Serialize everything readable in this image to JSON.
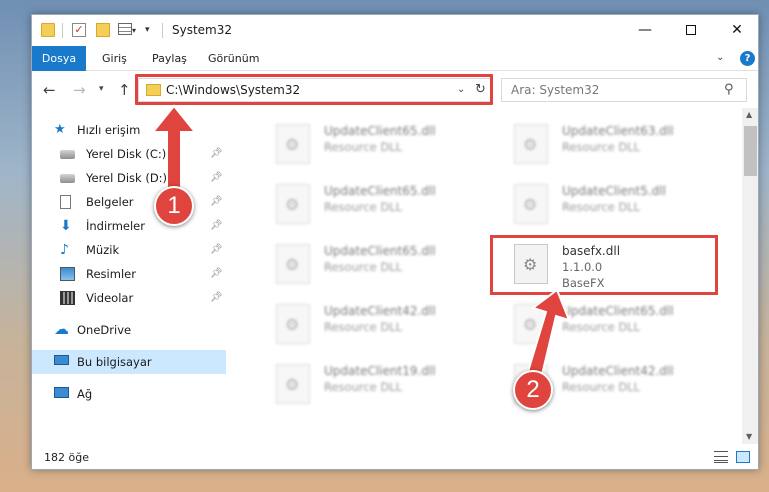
{
  "window": {
    "title": "System32",
    "controls": {
      "minimize": "—",
      "close": "✕"
    }
  },
  "ribbon": {
    "tabs": [
      "Dosya",
      "Giriş",
      "Paylaş",
      "Görünüm"
    ],
    "help": "?"
  },
  "address": {
    "path": "C:\\Windows\\System32",
    "search_placeholder": "Ara: System32"
  },
  "sidebar": {
    "items": [
      {
        "label": "Hızlı erişim",
        "icon": "star-icon"
      },
      {
        "label": "Yerel Disk (C:)",
        "icon": "disk-icon"
      },
      {
        "label": "Yerel Disk (D:)",
        "icon": "disk-icon"
      },
      {
        "label": "Belgeler",
        "icon": "documents-icon"
      },
      {
        "label": "İndirmeler",
        "icon": "downloads-icon"
      },
      {
        "label": "Müzik",
        "icon": "music-icon"
      },
      {
        "label": "Resimler",
        "icon": "pictures-icon"
      },
      {
        "label": "Videolar",
        "icon": "videos-icon"
      },
      {
        "label": "OneDrive",
        "icon": "onedrive-icon"
      },
      {
        "label": "Bu bilgisayar",
        "icon": "this-pc-icon",
        "selected": true
      },
      {
        "label": "Ağ",
        "icon": "network-icon"
      }
    ]
  },
  "files": [
    {
      "name": "UpdateClient65.dll",
      "desc": "Resource DLL"
    },
    {
      "name": "UpdateClient63.dll",
      "desc": "Resource DLL"
    },
    {
      "name": "UpdateClient65.dll",
      "desc": "Resource DLL"
    },
    {
      "name": "UpdateClient5.dll",
      "desc": "Resource DLL"
    },
    {
      "name": "UpdateClient65.dll",
      "desc": "Resource DLL"
    },
    {
      "name": "basefx.dll",
      "version": "1.1.0.0",
      "desc": "BaseFX",
      "highlighted": true
    },
    {
      "name": "UpdateClient42.dll",
      "desc": "Resource DLL"
    },
    {
      "name": "UpdateClient65.dll",
      "desc": "Resource DLL"
    },
    {
      "name": "UpdateClient19.dll",
      "desc": "Resource DLL"
    },
    {
      "name": "UpdateClient42.dll",
      "desc": "Resource DLL"
    }
  ],
  "status": {
    "count": "182 öğe"
  },
  "callouts": {
    "step1": "1",
    "step2": "2",
    "color": "#e0443e"
  }
}
